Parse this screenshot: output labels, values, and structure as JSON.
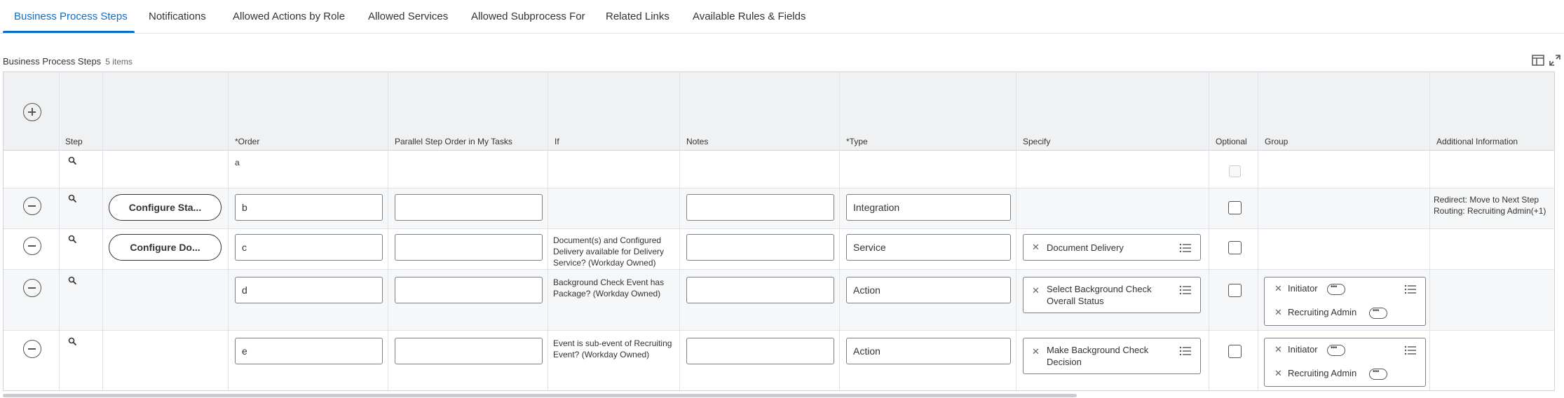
{
  "tabs": [
    {
      "label": "Business Process Steps",
      "active": true
    },
    {
      "label": "Notifications"
    },
    {
      "label": "Allowed Actions by Role"
    },
    {
      "label": "Allowed Services"
    },
    {
      "label": "Allowed Subprocess For"
    },
    {
      "label": "Related Links"
    },
    {
      "label": "Available Rules & Fields"
    }
  ],
  "grid": {
    "title": "Business Process Steps",
    "count": "5 items",
    "columns": [
      {
        "label": "Step"
      },
      {
        "label": ""
      },
      {
        "label": "*Order"
      },
      {
        "label": "Parallel Step Order in My Tasks"
      },
      {
        "label": "If"
      },
      {
        "label": "Notes"
      },
      {
        "label": "*Type"
      },
      {
        "label": "Specify"
      },
      {
        "label": "Optional"
      },
      {
        "label": "Group"
      },
      {
        "label": "Additional Information"
      }
    ],
    "rows": [
      {
        "order": "a",
        "parallel": "",
        "if": "",
        "notes": "",
        "type": "",
        "specify": "",
        "optional": false,
        "group": [],
        "additional": ""
      },
      {
        "configure": "Configure Sta...",
        "order": "b",
        "parallel": "",
        "if": "",
        "notes": "",
        "type": "Integration",
        "specify": "",
        "optional": false,
        "group": [],
        "additional": [
          "Redirect: Move to Next Step",
          "Routing: Recruiting Admin(+1)"
        ]
      },
      {
        "configure": "Configure Do...",
        "order": "c",
        "parallel": "",
        "if": "Document(s) and Configured Delivery available for Delivery Service? (Workday Owned)",
        "notes": "",
        "type": "Service",
        "specify": "Document Delivery",
        "optional": false,
        "group": [],
        "additional": ""
      },
      {
        "order": "d",
        "parallel": "",
        "if": "Background Check Event has Package? (Workday Owned)",
        "notes": "",
        "type": "Action",
        "specify": "Select Background Check Overall Status",
        "optional": false,
        "group": [
          "Initiator",
          "Recruiting Admin"
        ],
        "additional": ""
      },
      {
        "order": "e",
        "parallel": "",
        "if": "Event is sub-event of Recruiting Event? (Workday Owned)",
        "notes": "",
        "type": "Action",
        "specify": "Make Background Check Decision",
        "optional": false,
        "group": [
          "Initiator",
          "Recruiting Admin"
        ],
        "additional": ""
      }
    ]
  },
  "colors": {
    "accent": "#0b6fc9",
    "header_bg": "#f0f1f2",
    "alt_row_bg": "#f6f7f8",
    "border": "#cfd3d8"
  },
  "icons": [
    "add-row-icon",
    "remove-row-icon",
    "magnifier-icon",
    "list-icon",
    "clear-x-icon",
    "related-actions-icon",
    "view-options-icon",
    "expand-icon"
  ]
}
